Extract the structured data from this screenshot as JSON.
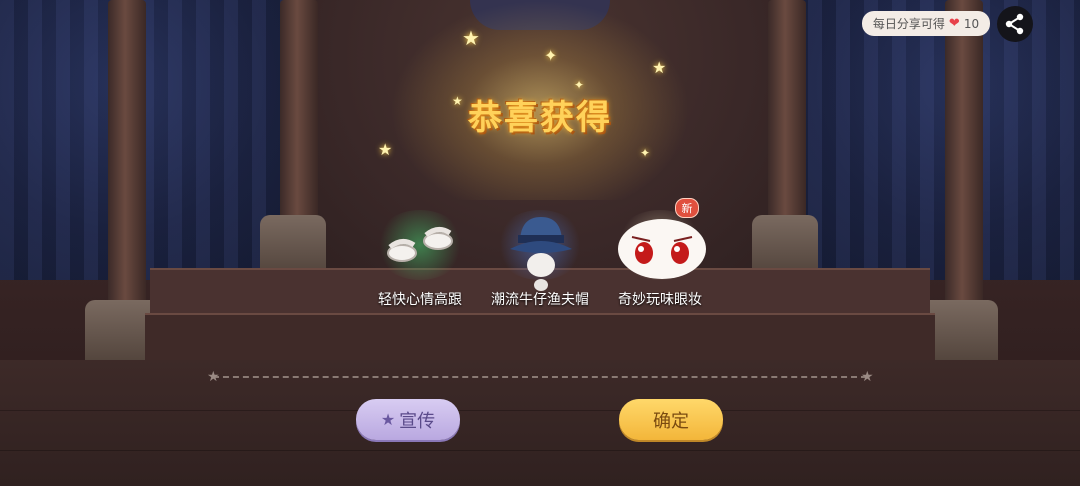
{
  "dialog": {
    "title": "恭喜获得"
  },
  "share": {
    "text": "每日分享可得",
    "count": "10",
    "heart_icon": "heart-icon",
    "share_icon": "share-icon"
  },
  "items": [
    {
      "name": "轻快心情高跟",
      "icon": "heels-icon",
      "glow_color": "#3fbf6a"
    },
    {
      "name": "潮流牛仔渔夫帽",
      "icon": "bucket-hat-icon",
      "glow_color": "#4a78d8"
    },
    {
      "name": "奇妙玩味眼妆",
      "icon": "eye-makeup-icon",
      "glow_color": "#ffffff",
      "badge": "新"
    }
  ],
  "buttons": {
    "promote": "宣传",
    "confirm": "确定"
  },
  "colors": {
    "title": "#ffd25a",
    "promote_bg": "#c8b8ea",
    "confirm_bg": "#f8c44c"
  }
}
